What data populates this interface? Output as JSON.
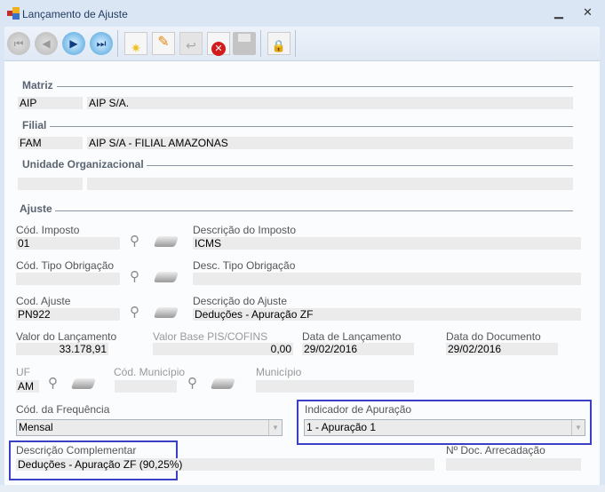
{
  "window": {
    "title": "Lançamento de Ajuste"
  },
  "toolbar": {
    "buttons": [
      "first-record",
      "previous-record",
      "next-record",
      "last-record",
      "new",
      "edit",
      "undo",
      "delete",
      "save",
      "lock"
    ]
  },
  "matriz": {
    "section": "Matriz",
    "code": "AIP",
    "name": "AIP S/A."
  },
  "filial": {
    "section": "Filial",
    "code": "FAM",
    "name": "AIP S/A - FILIAL AMAZONAS"
  },
  "unidade": {
    "section": "Unidade Organizacional",
    "code": "",
    "name": ""
  },
  "ajuste": {
    "section": "Ajuste",
    "cod_imposto": {
      "label": "Cód. Imposto",
      "value": "01"
    },
    "desc_imposto": {
      "label": "Descrição do Imposto",
      "value": "ICMS"
    },
    "cod_tipo_obrig": {
      "label": "Cód. Tipo Obrigação",
      "value": ""
    },
    "desc_tipo_obrig": {
      "label": "Desc. Tipo Obrigação",
      "value": ""
    },
    "cod_ajuste": {
      "label": "Cod. Ajuste",
      "value": "PN922"
    },
    "desc_ajuste": {
      "label": "Descrição do Ajuste",
      "value": "Deduções - Apuração ZF"
    },
    "valor_lanc": {
      "label": "Valor do Lançamento",
      "value": "33.178,91"
    },
    "valor_base": {
      "label": "Valor Base PIS/COFINS",
      "value": "0,00"
    },
    "data_lanc": {
      "label": "Data de Lançamento",
      "value": "29/02/2016"
    },
    "data_doc": {
      "label": "Data do Documento",
      "value": "29/02/2016"
    },
    "uf": {
      "label": "UF",
      "value": "AM"
    },
    "cod_municipio": {
      "label": "Cód. Município",
      "value": ""
    },
    "municipio": {
      "label": "Município",
      "value": ""
    },
    "frequencia": {
      "label": "Cód. da Frequência",
      "value": "Mensal"
    },
    "indicador": {
      "label": "Indicador de Apuração",
      "value": "1 - Apuração 1"
    },
    "desc_compl": {
      "label": "Descrição Complementar",
      "value": "Deduções - Apuração ZF (90,25%)"
    },
    "num_doc": {
      "label": "Nº Doc. Arrecadação",
      "value": ""
    }
  },
  "colors": {
    "highlight": "#3a3fc4",
    "field": "#ebebeb"
  }
}
